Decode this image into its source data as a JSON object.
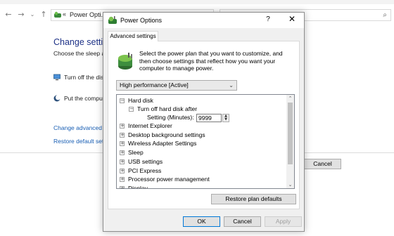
{
  "background_window": {
    "address_text": "Power Opti...",
    "breadcrumb_separator": "«",
    "heading": "Change setting",
    "subtitle": "Choose the sleep ar",
    "rows": [
      {
        "label": "Turn off the dis"
      },
      {
        "label": "Put the compu"
      }
    ],
    "links": [
      "Change advanced p",
      "Restore default setti"
    ],
    "cancel_label": "Cancel"
  },
  "dialog": {
    "title": "Power Options",
    "help_label": "?",
    "close_glyph": "✕",
    "tab_label": "Advanced settings",
    "intro": "Select the power plan that you want to customize, and then choose settings that reflect how you want your computer to manage power.",
    "plan_selected": "High performance [Active]",
    "tree": {
      "hard_disk": {
        "label": "Hard disk",
        "expander": "−"
      },
      "turn_off_hard_disk": {
        "label": "Turn off hard disk after",
        "expander": "−"
      },
      "setting_label": "Setting (Minutes):",
      "setting_value": "9999",
      "collapsed_items": [
        "Internet Explorer",
        "Desktop background settings",
        "Wireless Adapter Settings",
        "Sleep",
        "USB settings",
        "PCI Express",
        "Processor power management",
        "Display"
      ],
      "collapsed_expander": "+"
    },
    "restore_label": "Restore plan defaults",
    "buttons": {
      "ok": "OK",
      "cancel": "Cancel",
      "apply": "Apply"
    }
  },
  "colors": {
    "accent_link": "#1a5fb4",
    "heading_blue": "#1e3287",
    "ok_border": "#0078d7"
  },
  "icons": [
    "back-icon",
    "forward-icon",
    "recent-icon",
    "up-icon",
    "power-options-icon",
    "search-icon",
    "display-icon",
    "moon-icon"
  ]
}
